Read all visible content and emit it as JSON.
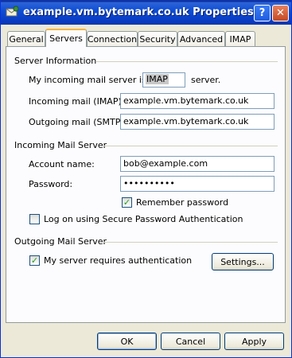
{
  "window": {
    "title": "example.vm.bytemark.co.uk Properties",
    "help_glyph": "?",
    "close_glyph": "✕"
  },
  "tabs": [
    {
      "label": "General",
      "active": false
    },
    {
      "label": "Servers",
      "active": true
    },
    {
      "label": "Connection",
      "active": false
    },
    {
      "label": "Security",
      "active": false
    },
    {
      "label": "Advanced",
      "active": false
    },
    {
      "label": "IMAP",
      "active": false
    }
  ],
  "server_information": {
    "section_label": "Server Information",
    "incoming_type_prefix": "My incoming mail server is a",
    "incoming_type_value": "IMAP",
    "incoming_type_suffix": "server.",
    "incoming_label": "Incoming mail (IMAP):",
    "incoming_value": "example.vm.bytemark.co.uk",
    "outgoing_label": "Outgoing mail (SMTP):",
    "outgoing_value": "example.vm.bytemark.co.uk"
  },
  "incoming_mail_server": {
    "section_label": "Incoming Mail Server",
    "account_label": "Account name:",
    "account_value": "bob@example.com",
    "password_label": "Password:",
    "password_value": "••••••••••",
    "remember_label": "Remember password",
    "remember_checked": true,
    "spa_label": "Log on using Secure Password Authentication",
    "spa_checked": false
  },
  "outgoing_mail_server": {
    "section_label": "Outgoing Mail Server",
    "auth_label": "My server requires authentication",
    "auth_checked": true,
    "settings_button": "Settings..."
  },
  "footer": {
    "ok": "OK",
    "cancel": "Cancel",
    "apply": "Apply"
  },
  "colors": {
    "titlebar": "#0a3fc8",
    "dialog_bg": "#ece9d8",
    "panel_bg": "#fcfcfe",
    "checkmark": "#21a121",
    "tab_highlight": "#f5b543"
  },
  "icons": {
    "title": "mail-account-icon",
    "check": "✓"
  }
}
